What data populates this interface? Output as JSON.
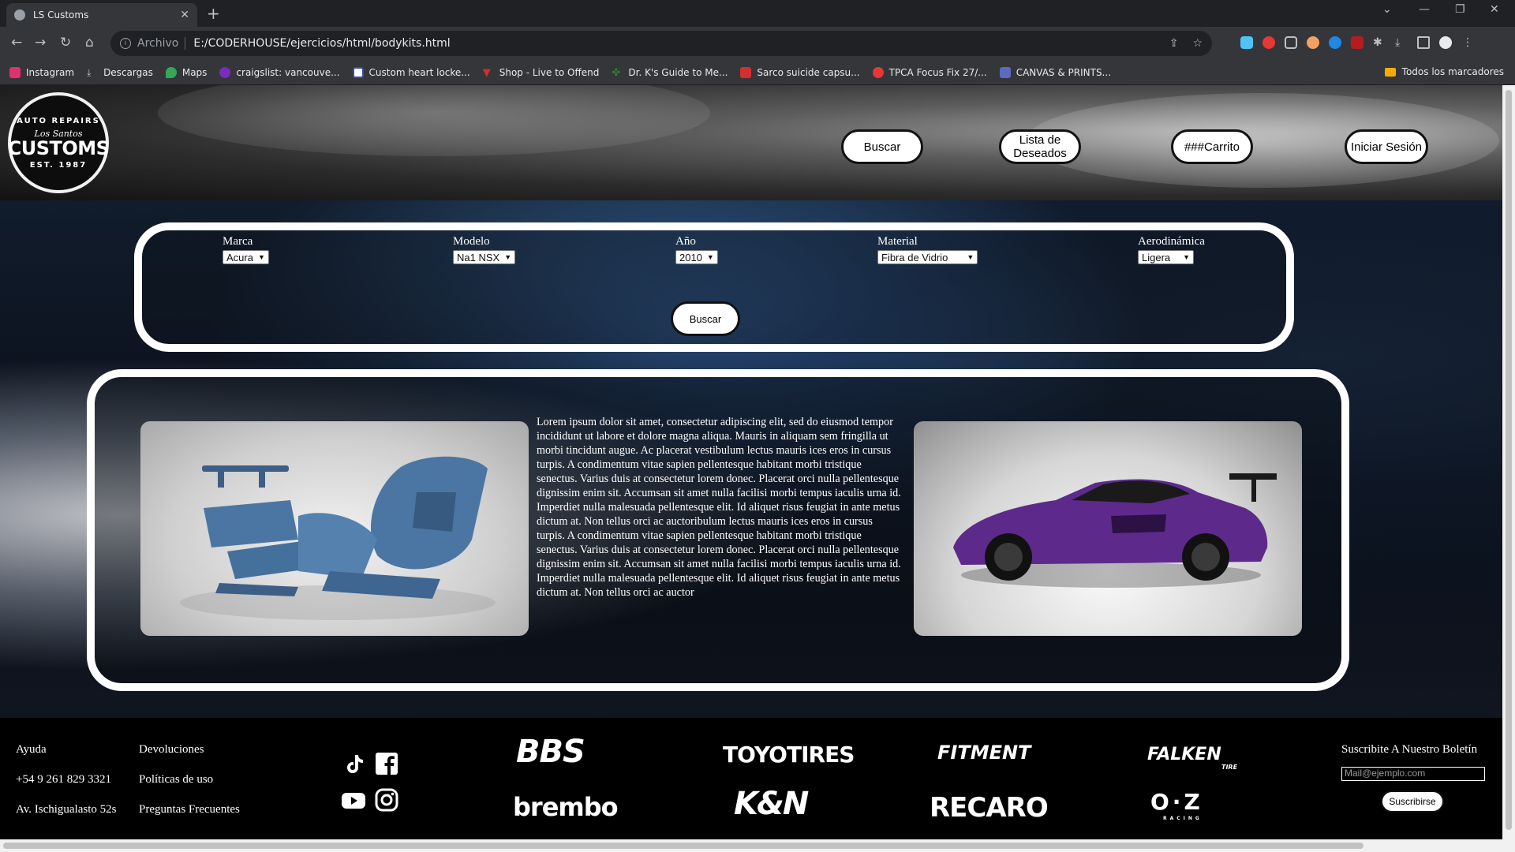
{
  "browser": {
    "tab_title": "LS Customs",
    "scheme_label": "Archivo",
    "url": "E:/CODERHOUSE/ejercicios/html/bodykits.html",
    "bookmarks": [
      {
        "label": "Instagram",
        "color": "#e1306c"
      },
      {
        "label": "Descargas",
        "color": "#bdc1c6"
      },
      {
        "label": "Maps",
        "color": "#34a853"
      },
      {
        "label": "craigslist: vancouve...",
        "color": "#7b2cbf"
      },
      {
        "label": "Custom heart locke...",
        "color": "#ffffff"
      },
      {
        "label": "Shop - Live to Offend",
        "color": "#d32f2f"
      },
      {
        "label": "Dr. K's Guide to Me...",
        "color": "#2e7d32"
      },
      {
        "label": "Sarco suicide capsu...",
        "color": "#d32f2f"
      },
      {
        "label": "TPCA Focus Fix 27/...",
        "color": "#e53935"
      },
      {
        "label": "CANVAS & PRINTS...",
        "color": "#5c6bc0"
      }
    ],
    "all_bookmarks": "Todos los marcadores"
  },
  "header": {
    "logo": {
      "top": "AUTO REPAIRS",
      "script": "Los Santos",
      "main": "CUSTOMS",
      "bottom": "EST. 1987"
    },
    "buttons": {
      "buscar": "Buscar",
      "wishlist_line1": "Lista de",
      "wishlist_line2": "Deseados",
      "cart": "###Carrito",
      "login": "Iniciar Sesión"
    }
  },
  "filters": {
    "brand": {
      "label": "Marca",
      "value": "Acura"
    },
    "model": {
      "label": "Modelo",
      "value": "Na1 NSX"
    },
    "year": {
      "label": "Año",
      "value": "2010"
    },
    "material": {
      "label": "Material",
      "value": "Fibra de Vidrio"
    },
    "aero": {
      "label": "Aerodinámica",
      "value": "Ligera"
    },
    "search_button": "Buscar"
  },
  "product": {
    "description": "Lorem ipsum dolor sit amet, consectetur adipiscing elit, sed do eiusmod tempor incididunt ut labore et dolore magna aliqua. Mauris in aliquam sem fringilla ut morbi tincidunt augue. Ac placerat vestibulum lectus mauris ices eros in cursus turpis. A condimentum vitae sapien pellentesque habitant morbi tristique senectus. Varius duis at consectetur lorem donec. Placerat orci nulla pellentesque dignissim enim sit. Accumsan sit amet nulla facilisi morbi tempus iaculis urna id. Imperdiet nulla malesuada pellentesque elit. Id aliquet risus feugiat in ante metus dictum at. Non tellus orci ac auctoribulum lectus mauris ices eros in cursus turpis. A condimentum vitae sapien pellentesque habitant morbi tristique senectus. Varius duis at consectetur lorem donec. Placerat orci nulla pellentesque dignissim enim sit. Accumsan sit amet nulla facilisi morbi tempus iaculis urna id. Imperdiet nulla malesuada pellentesque elit. Id aliquet risus feugiat in ante metus dictum at. Non tellus orci ac auctor"
  },
  "footer": {
    "links_col1": [
      "Ayuda",
      "+54 9 261 829 3321",
      "Av. Ischigualasto 52s"
    ],
    "links_col2": [
      "Devoluciones",
      "Políticas de uso",
      "Preguntas Frecuentes"
    ],
    "brands": {
      "bbs": "BBS",
      "toyo": "TOYOTIRES",
      "fitment": "FITMENT",
      "falken": "FALKEN",
      "falken_sub": "TIRE",
      "brembo": "brembo",
      "kn": "K&N",
      "recaro": "RECARO",
      "oz": "O·Z",
      "oz_sub": "RACING"
    },
    "newsletter": {
      "title": "Suscribite A Nuestro Boletín",
      "placeholder": "Mail@ejemplo.com",
      "button": "Suscribirse"
    }
  }
}
